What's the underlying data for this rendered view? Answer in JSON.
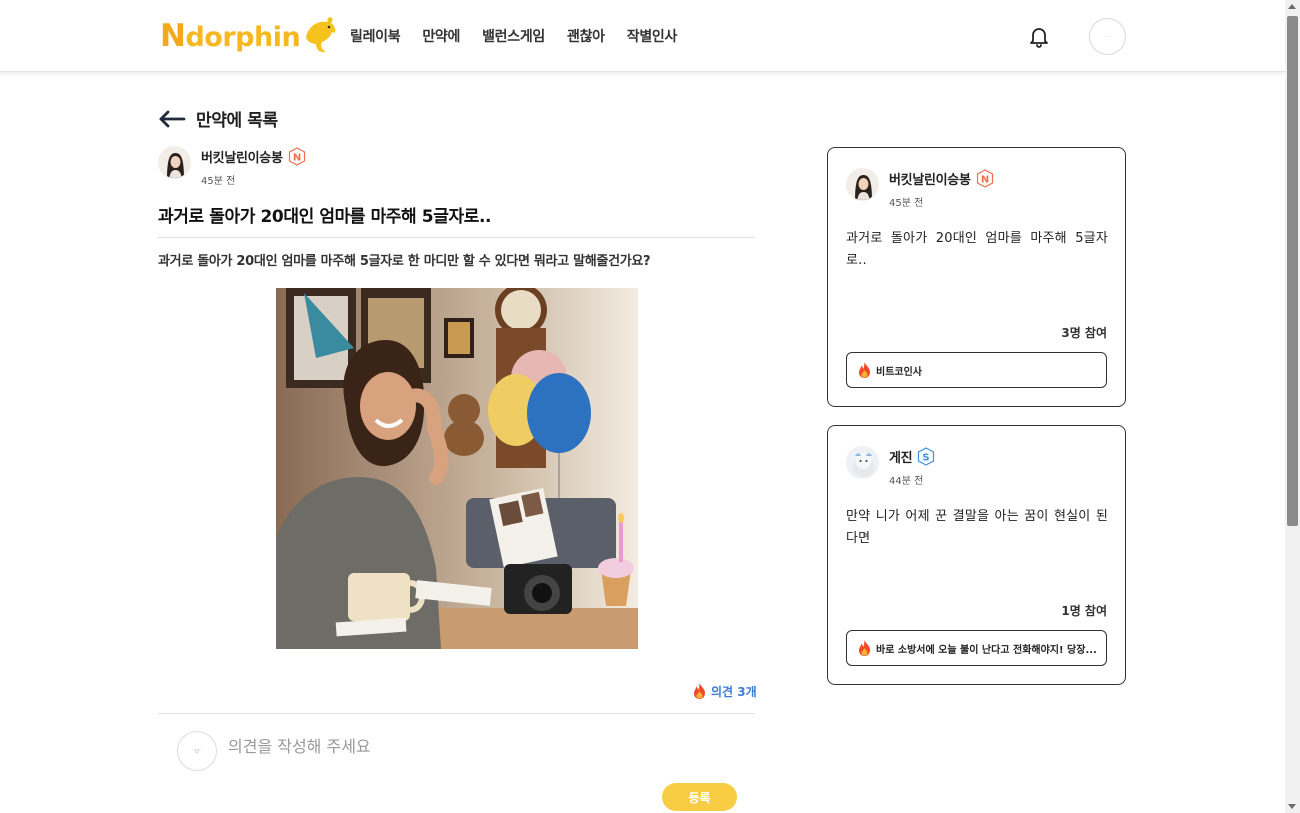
{
  "header": {
    "logo_text": "Ndorphin",
    "nav": [
      "릴레이북",
      "만약에",
      "밸런스게임",
      "괜찮아",
      "작별인사"
    ],
    "user_avatar_text": "·· ·"
  },
  "post": {
    "back_label": "만약에 목록",
    "author_name": "버킷날린이승봉",
    "author_badge": "N",
    "time": "45분 전",
    "title": "과거로 돌아가 20대인 엄마를 마주해 5글자로..",
    "body": "과거로 돌아가 20대인 엄마를 마주해 5글자로 한 마디만 할 수 있다면 뭐라고 말해줄건가요?",
    "opinion_count": "의견 3개"
  },
  "comment": {
    "avatar_text": "'ㅁ'",
    "placeholder": "의견을 작성해 주세요",
    "submit_label": "등록"
  },
  "cards": [
    {
      "author_name": "버킷날린이승봉",
      "badge": "N",
      "time": "45분 전",
      "text": "과거로 돌아가 20대인 엄마를 마주해 5글자로..",
      "participants": "3명 참여",
      "best_comment": "비트코인사"
    },
    {
      "author_name": "게진",
      "badge": "S",
      "time": "44분 전",
      "text": "만약 니가 어제 꾼 결말을 아는 꿈이 현실이 된다면",
      "participants": "1명 참여",
      "best_comment": "바로 소방서에 오늘 불이 난다고 전화해야지! 당장..."
    }
  ],
  "colors": {
    "brand": "#f6b820",
    "badge_n": "#f06d4f",
    "badge_s": "#3b8fe0",
    "link": "#3b7bd9",
    "submit": "#f8cc43"
  },
  "icons": {
    "back": "arrow-left-icon",
    "notification": "bell-icon",
    "fire": "fire-icon"
  }
}
